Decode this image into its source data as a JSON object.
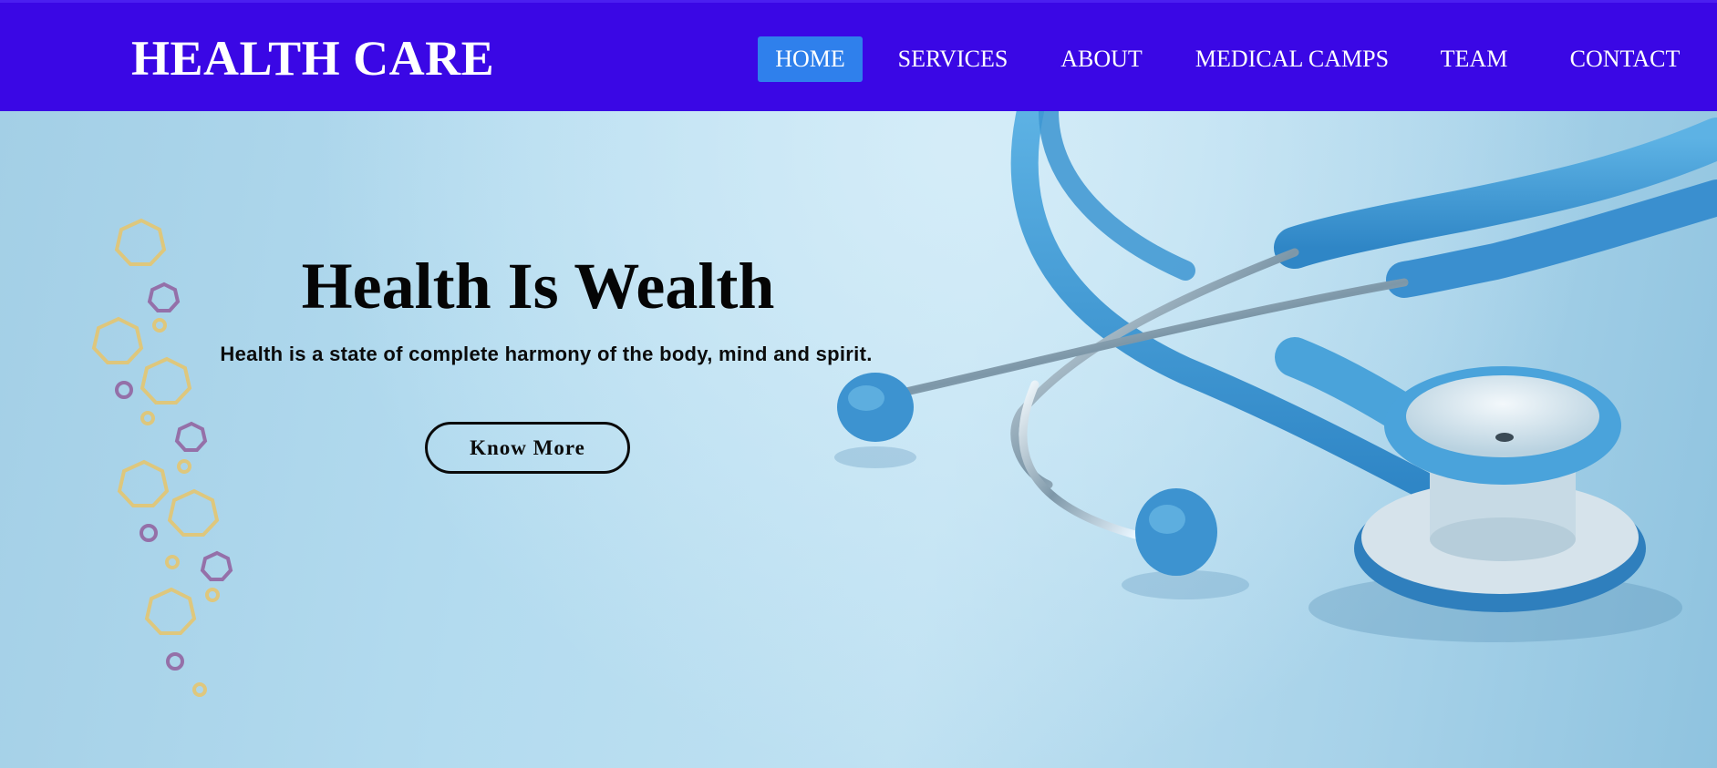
{
  "header": {
    "brand": "HEALTH CARE",
    "nav": [
      {
        "label": "HOME",
        "active": true
      },
      {
        "label": "SERVICES",
        "active": false
      },
      {
        "label": "ABOUT",
        "active": false
      },
      {
        "label": "MEDICAL CAMPS",
        "active": false
      },
      {
        "label": "TEAM",
        "active": false
      },
      {
        "label": "CONTACT",
        "active": false
      }
    ]
  },
  "hero": {
    "title": "Health Is Wealth",
    "subtitle": "Health is a state of complete harmony of the body, mind and spirit.",
    "cta_label": "Know More",
    "image_subject": "stethoscope",
    "decoration": "floral-pattern"
  },
  "colors": {
    "navbar": "#3a07e5",
    "nav_active": "#2f80ec",
    "hero_bg": "#b3dbef",
    "stethoscope_blue": "#3f9bd6"
  }
}
